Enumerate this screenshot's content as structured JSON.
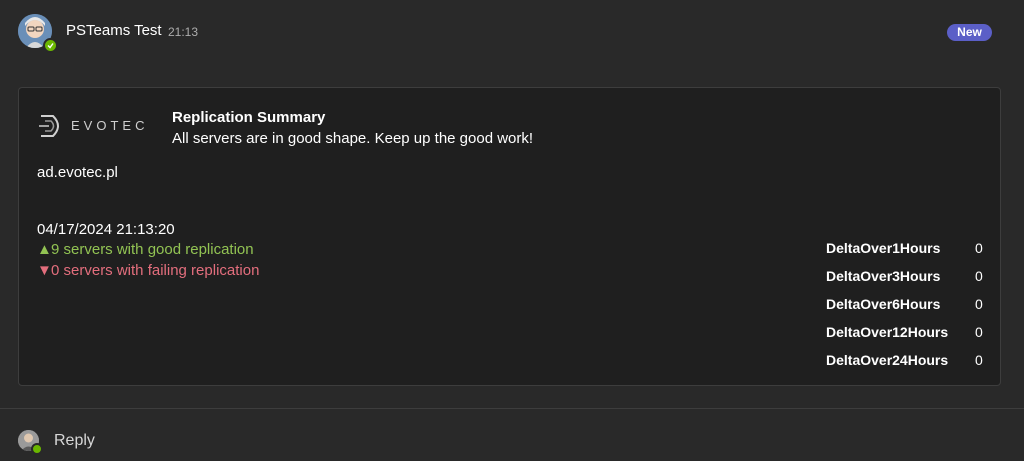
{
  "message": {
    "sender": "PSTeams Test",
    "time": "21:13",
    "badge": "New",
    "avatar_icon": "avatar-icon",
    "presence_status": "available"
  },
  "card": {
    "logo_text": "EVOTEC",
    "title": "Replication Summary",
    "subtitle": "All servers are in good shape. Keep up the good work!",
    "domain": "ad.evotec.pl",
    "timestamp": "04/17/2024 21:13:20",
    "good": {
      "icon": "▲",
      "text": "9 servers with good replication",
      "color": "#92c353"
    },
    "bad": {
      "icon": "▼",
      "text": "0 servers with failing replication",
      "color": "#e36e7d"
    },
    "deltas": [
      {
        "label": "DeltaOver1Hours",
        "value": "0"
      },
      {
        "label": "DeltaOver3Hours",
        "value": "0"
      },
      {
        "label": "DeltaOver6Hours",
        "value": "0"
      },
      {
        "label": "DeltaOver12Hours",
        "value": "0"
      },
      {
        "label": "DeltaOver24Hours",
        "value": "0"
      }
    ]
  },
  "reply": {
    "label": "Reply"
  },
  "colors": {
    "background": "#292929",
    "card": "#1f1f1f",
    "accent": "#5b5fc7",
    "presence": "#6bb700"
  }
}
